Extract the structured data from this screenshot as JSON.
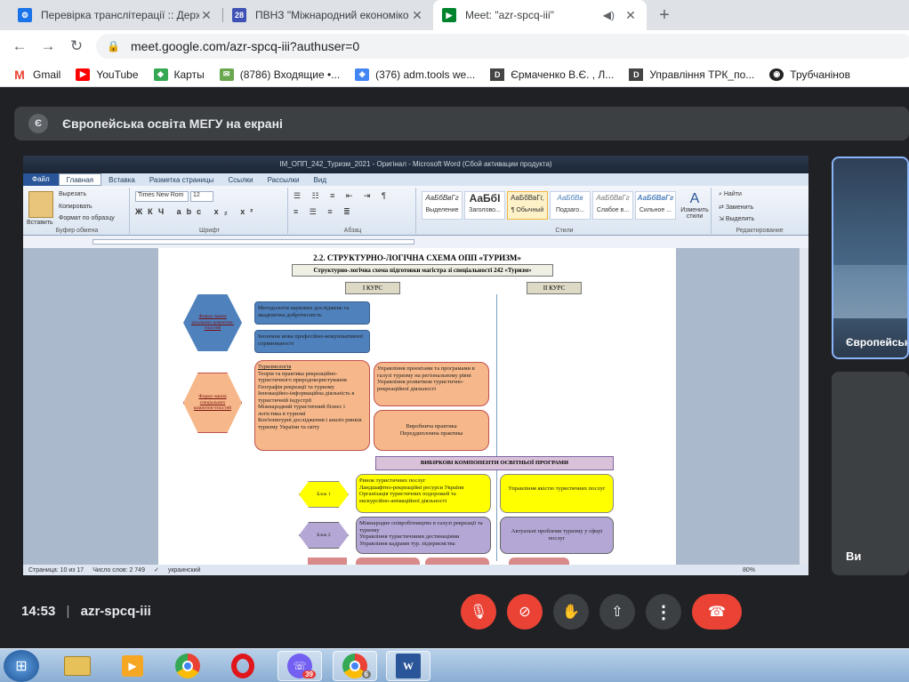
{
  "browser": {
    "tabs": [
      {
        "title": "Перевірка транслітерації :: Держ",
        "active": false
      },
      {
        "title": "ПВНЗ \"Міжнародний економіко",
        "active": false
      },
      {
        "title": "Meet: \"azr-spcq-iii\"",
        "active": true
      }
    ],
    "new_tab": "+",
    "url": "meet.google.com/azr-spcq-iii?authuser=0",
    "bookmarks": [
      "Gmail",
      "YouTube",
      "Карты",
      "(8786) Входящие •...",
      "(376) adm.tools we...",
      "Єрмаченко В.Є. , Л...",
      "Управління ТРК_по...",
      "Трубчанінов"
    ]
  },
  "meet": {
    "presenter_initial": "Є",
    "presenting_label": "Європейська освіта МЕГУ на екрані",
    "tile1_name": "Європейськ",
    "tile2_name": "Ви",
    "time": "14:53",
    "meeting_code": "azr-spcq-iii"
  },
  "word": {
    "title": "IM_ОПП_242_Туризм_2021 - Оригінал - Microsoft Word (Сбой активации продукта)",
    "tabs": [
      "Файл",
      "Главная",
      "Вставка",
      "Разметка страницы",
      "Ссылки",
      "Рассылки",
      "Вид"
    ],
    "clipboard": {
      "paste": "Вставить",
      "cut": "Вырезать",
      "copy": "Копировать",
      "format": "Формат по образцу",
      "group": "Буфер обмена"
    },
    "font": {
      "name": "Times New Rom",
      "size": "12",
      "group": "Шрифт"
    },
    "paragraph_group": "Абзац",
    "styles": [
      {
        "sample": "АаБбВвГг",
        "name": "Выделение"
      },
      {
        "sample": "АаБбІ",
        "name": "Заголово..."
      },
      {
        "sample": "АаБбВвГг,",
        "name": "¶ Обычный"
      },
      {
        "sample": "АаБбВв",
        "name": "Подзаго..."
      },
      {
        "sample": "АаБбВвГг",
        "name": "Слабое в..."
      },
      {
        "sample": "АаБбВвГг",
        "name": "Сильное ..."
      }
    ],
    "change_styles": "Изменить стили",
    "styles_group": "Стили",
    "editing": {
      "find": "Найти",
      "replace": "Заменить",
      "select": "Выделить",
      "group": "Редактирование"
    },
    "status": {
      "page": "Страница: 10 из 17",
      "words": "Число слов: 2 749",
      "lang": "украинский",
      "zoom": "80%"
    }
  },
  "document": {
    "heading": "2.2. СТРУКТУРНО-ЛОГІЧНА СХЕМА ОПП «ТУРИЗМ»",
    "subheading": "Структурно-логічна схема підготовки магістра зі спеціальності 242 «Туризм»",
    "course1": "І КУРС",
    "course2": "ІІ КУРС",
    "hex1": "Форму-вання загальних компетен-тностей",
    "hex2": "Форму-вання спеціальних компетен-тностей",
    "blue1": "Методологія наукових досліджень та академічна доброчесність",
    "blue2": "Іноземна мова професійно-комунікативної спрямованості",
    "orange_left": [
      "Туризмологія",
      "Теорія та практика рекреаційно-туристичного природокористування",
      "Географія рекреації та туризму",
      "Інноваційно-інформаційна діяльність в туристичній індустрії",
      "Міжнародний туристичний бізнес і логістика в туризмі",
      "Кон'юнктурні дослідження і аналіз ринків туризму України та світу"
    ],
    "orange_right1": [
      "Управління проектами та програмами в галузі туризму на регіональному рівні",
      "Управління розвитком туристично-рекреаційної діяльності"
    ],
    "orange_right2": [
      "Виробнича практика",
      "Переддипломна практика"
    ],
    "elective_header": "ВИБІРКОВІ КОМПОНЕНТИ ОСВІТНЬОЇ ПРОГРАМИ",
    "block1": "Блок 1",
    "block2": "Блок 2",
    "yellow_left": [
      "Ринок туристичних послуг",
      "Ландшафтно-рекреаційні ресурси України",
      "Організація туристичних подорожей та екскурсійно-анімаційної діяльності"
    ],
    "yellow_right": "Управління якістю туристичних послуг",
    "purple_left": [
      "Міжнародне співробітництво в галузі рекреації та туризму",
      "Управління туристичними дестинаціями",
      "Управління кадрами тур. підприємства"
    ],
    "purple_right": "Актуальні проблеми туризму у сфері послуг"
  },
  "taskbar": {
    "viber_badge": "39",
    "chrome_badge": "6"
  },
  "colors": {
    "blue": "#4f81bd",
    "orange": "#f6b88a",
    "yellow": "#ffff00",
    "purple": "#b4a7d6",
    "end_call": "#ea4335"
  }
}
